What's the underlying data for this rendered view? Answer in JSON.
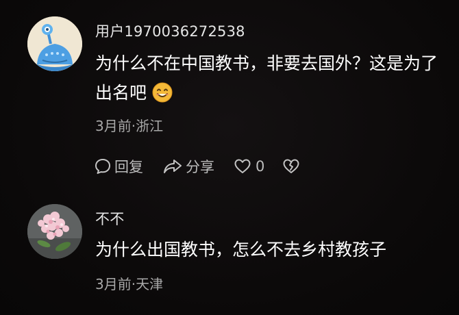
{
  "comments": [
    {
      "username": "用户1970036272538",
      "content": "为什么不在中国教书，非要去国外？这是为了出名吧",
      "emoji": "smile-emoji",
      "meta": "3月前·浙江",
      "actions": {
        "reply_label": "回复",
        "share_label": "分享",
        "like_count": "0"
      }
    },
    {
      "username": "不不",
      "content": "为什么出国教书，怎么不去乡村教孩子",
      "meta": "3月前·天津"
    }
  ],
  "icons": {
    "reply": "comment-bubble-icon",
    "share": "share-arrow-icon",
    "like": "heart-outline-icon",
    "dislike": "broken-heart-icon"
  },
  "colors": {
    "background": "#0c0a0a",
    "text_primary": "#ffffff",
    "text_secondary": "#a9a9a9",
    "avatar1_accent": "#4fa3e6"
  }
}
